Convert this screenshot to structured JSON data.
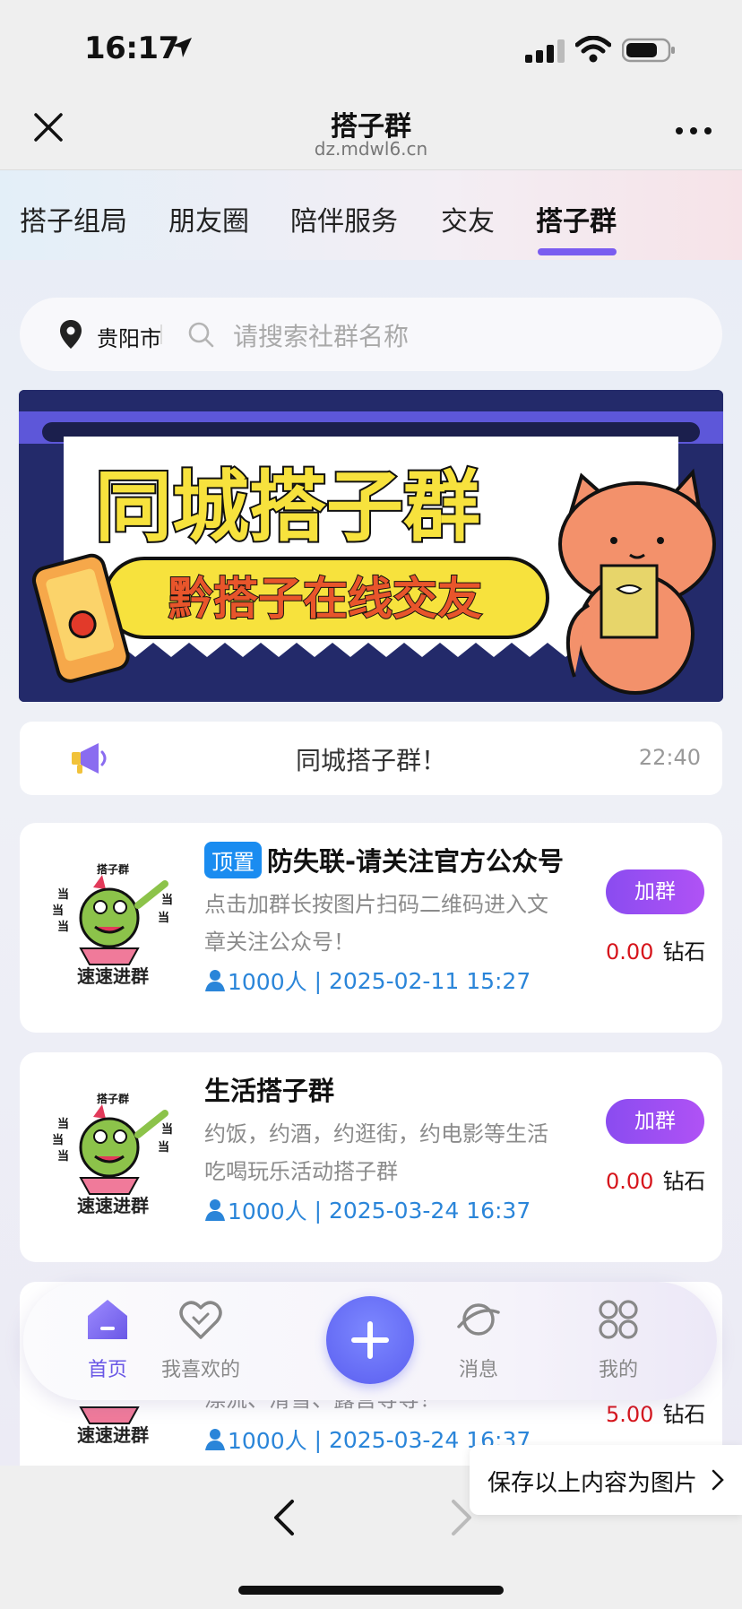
{
  "status_bar": {
    "time": "16:17"
  },
  "nav": {
    "title": "搭子群",
    "subtitle": "dz.mdwl6.cn"
  },
  "tabs": [
    {
      "label": "搭子组局"
    },
    {
      "label": "朋友圈"
    },
    {
      "label": "陪伴服务"
    },
    {
      "label": "交友"
    },
    {
      "label": "搭子群",
      "active": true
    }
  ],
  "search": {
    "city": "贵阳市",
    "placeholder": "请搜索社群名称"
  },
  "banner": {
    "title": "同城搭子群",
    "subtitle": "黔搭子在线交友"
  },
  "notice": {
    "text": "同城搭子群！",
    "time": "22:40"
  },
  "groups": [
    {
      "badge": "顶置",
      "title": "防失联-请关注官方公众号",
      "description": "点击加群长按图片扫码二维码进入文章关注公众号！",
      "members": "1000人",
      "date": "2025-02-11 15:27",
      "join_label": "加群",
      "price": "0.00",
      "unit": "钻石",
      "thumb_label": "速速进群",
      "thumb_top": "搭子群"
    },
    {
      "title": "生活搭子群",
      "description": "约饭，约酒，约逛街，约电影等生活吃喝玩乐活动搭子群",
      "members": "1000人",
      "date": "2025-03-24 16:37",
      "join_label": "加群",
      "price": "0.00",
      "unit": "钻石",
      "thumb_label": "速速进群",
      "thumb_top": "搭子群"
    },
    {
      "description_peek": "漂流、滑雪、露营等等！",
      "members": "1000人",
      "date": "2025-03-24 16:37",
      "price": "5.00",
      "unit": "钻石",
      "thumb_label": "速速进群"
    }
  ],
  "bottom_tabs": [
    {
      "label": "首页",
      "active": true,
      "icon": "home-icon"
    },
    {
      "label": "我喜欢的",
      "icon": "heart-icon"
    },
    {
      "label": "",
      "icon": "plus-icon"
    },
    {
      "label": "消息",
      "icon": "planet-icon"
    },
    {
      "label": "我的",
      "icon": "grid-icon"
    }
  ],
  "save_chip": {
    "text": "保存以上内容为图片"
  },
  "colors": {
    "accent": "#7a5cf0",
    "link": "#2a85d9",
    "price": "#d6141b",
    "badge": "#1a8cf0"
  }
}
